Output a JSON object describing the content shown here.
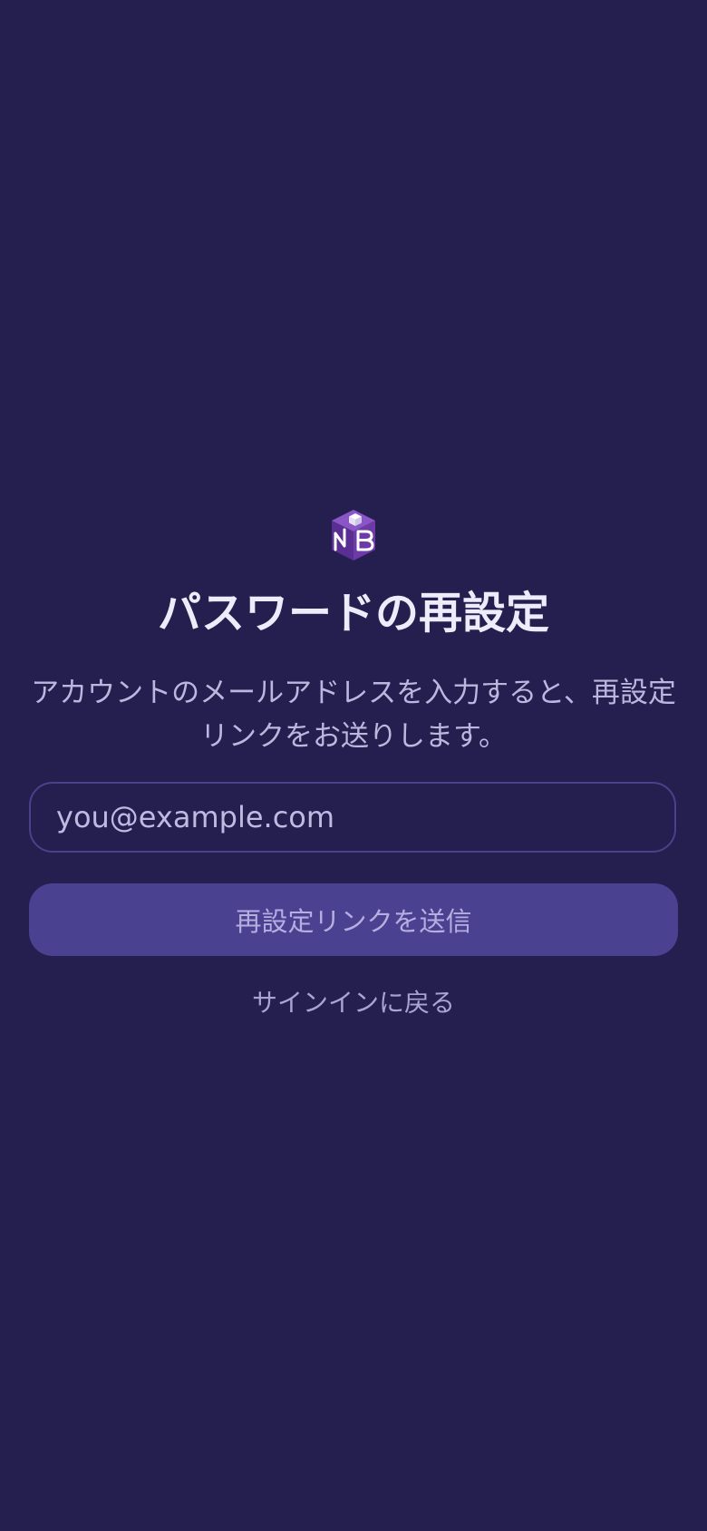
{
  "app": {
    "logo_letters": "NB",
    "logo_icon": "nb-cube-logo-icon"
  },
  "page": {
    "title": "パスワードの再設定",
    "description": "アカウントのメールアドレスを入力すると、再設定リンクをお送りします。"
  },
  "form": {
    "email": {
      "value": "",
      "placeholder": "you@example.com"
    },
    "submit_label": "再設定リンクを送信",
    "back_link_label": "サインインに戻る"
  },
  "colors": {
    "background": "#241f4f",
    "input_border": "#4a4289",
    "button_background": "#4a4290",
    "title_text": "#eeebfa",
    "muted_text": "#bdb6de",
    "logo_purple": "#6d3aa8"
  }
}
